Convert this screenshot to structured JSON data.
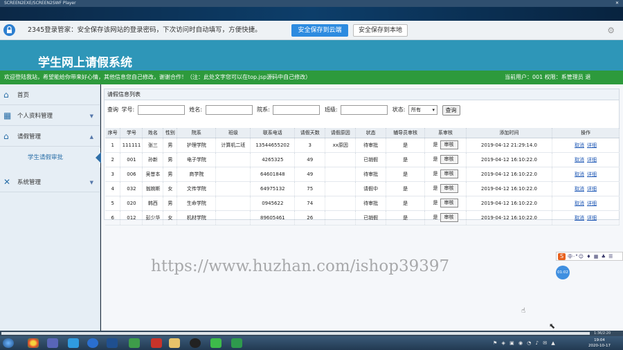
{
  "window": {
    "title": "SCREEN2EXE/SCREEN2SWF Player"
  },
  "password_bar": {
    "message": "2345登录管家：安全保存该网站的登录密码，下次访问时自动填写，方便快捷。",
    "save_cloud": "安全保存到云端",
    "save_local": "安全保存到本地"
  },
  "header": {
    "title": "学生网上请假系统"
  },
  "notice": {
    "welcome": "欢迎登陆我站，希望能给你带来好心情，其他信息您自己修改，谢谢合作！（注：此处文字您可以在top.jsp源码中自己修改）",
    "user_info": "当前用户：001   权限：系管理员  退"
  },
  "sidebar": {
    "items": [
      {
        "label": "首页",
        "icon": "home-icon"
      },
      {
        "label": "个人资料管理",
        "icon": "grid-icon"
      },
      {
        "label": "请假管理",
        "icon": "home-icon"
      },
      {
        "label": "系统管理",
        "icon": "tools-icon"
      }
    ],
    "subitem": "学生请假审批"
  },
  "panel": {
    "title": "请假信息列表",
    "search": {
      "query_label": "查询",
      "student_id": "学号:",
      "name": "姓名:",
      "department": "院系:",
      "class": "班级:",
      "status": "状态:",
      "status_value": "所有",
      "button": "查询"
    },
    "columns": [
      "序号",
      "学号",
      "姓名",
      "性别",
      "院系",
      "班级",
      "联系电话",
      "请假天数",
      "请假原因",
      "状态",
      "辅导员审核",
      "系审核",
      "添加时间",
      "操作"
    ],
    "rows": [
      {
        "idx": "1",
        "sid": "111111",
        "name": "张三",
        "gender": "男",
        "dept": "护理学院",
        "cls": "计算机二班",
        "phone": "13544655202",
        "days": "3",
        "reason": "xx原因",
        "status": "待审批",
        "counselor": "是",
        "dean": "是",
        "time": "2019-04-12 21:29:14.0"
      },
      {
        "idx": "2",
        "sid": "001",
        "name": "孙新",
        "gender": "男",
        "dept": "电子学院",
        "cls": "",
        "phone": "4265325",
        "days": "49",
        "reason": "",
        "status": "已销假",
        "counselor": "是",
        "dean": "是",
        "time": "2019-04-12 16:10:22.0"
      },
      {
        "idx": "3",
        "sid": "006",
        "name": "吴昔本",
        "gender": "男",
        "dept": "商学院",
        "cls": "",
        "phone": "64601848",
        "days": "49",
        "reason": "",
        "status": "待审批",
        "counselor": "是",
        "dean": "是",
        "time": "2019-04-12 16:10:22.0"
      },
      {
        "idx": "4",
        "sid": "032",
        "name": "翁婉斯",
        "gender": "女",
        "dept": "文传学院",
        "cls": "",
        "phone": "64975132",
        "days": "75",
        "reason": "",
        "status": "请假中",
        "counselor": "是",
        "dean": "是",
        "time": "2019-04-12 16:10:22.0"
      },
      {
        "idx": "5",
        "sid": "020",
        "name": "韩西",
        "gender": "男",
        "dept": "生命学院",
        "cls": "",
        "phone": "0945622",
        "days": "74",
        "reason": "",
        "status": "待审批",
        "counselor": "是",
        "dean": "是",
        "time": "2019-04-12 16:10:22.0"
      },
      {
        "idx": "6",
        "sid": "012",
        "name": "彭少华",
        "gender": "女",
        "dept": "机材学院",
        "cls": "",
        "phone": "89605461",
        "days": "26",
        "reason": "",
        "status": "已销假",
        "counselor": "是",
        "dean": "是",
        "time": "2019-04-12 16:10:22.0"
      }
    ],
    "review_button": "审核",
    "action_cancel": "取消",
    "action_detail": "详细"
  },
  "watermark": "https://www.huzhan.com/ishop39397",
  "ime": {
    "logo": "S",
    "text": "中·°☺ ♦ ▦ ♣ ☰"
  },
  "circle_badge": "01:02",
  "player": {
    "time": "1:36/2:20"
  },
  "taskbar": {
    "clock_time": "19:04",
    "clock_date": "2020-10-17",
    "tray": "⚑ ◈ ▣ ◉ ◔ ♪ ✉ ▲"
  },
  "colors": {
    "header": "#2e96b8",
    "notice": "#2d9a3c",
    "link": "#1d57b5"
  }
}
